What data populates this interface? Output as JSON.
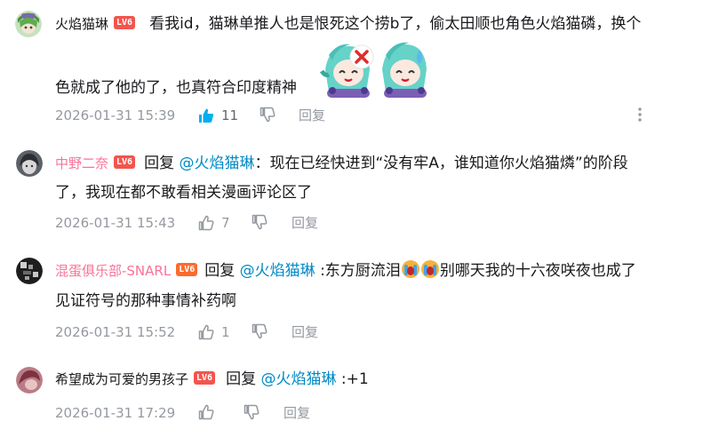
{
  "comments": [
    {
      "user": "火焰猫琳",
      "level": "LV6",
      "text_line1": "看我id，猫琳单推人也是恨死这个捞b了，偷太田顺也角色火焰猫磷，换个",
      "text_line2": "色就成了他的了，也真符合印度精神",
      "time": "2026-01-31 15:39",
      "likes": "11",
      "reply_label": "回复"
    },
    {
      "user": "中野二奈",
      "level": "LV6",
      "reply_prefix": "回复",
      "mention": "@火焰猫琳",
      "text_line1": "：现在已经快进到“没有牢A，谁知道你火焰猫燐”的阶段",
      "text_line2": "了，我现在都不敢看相关漫画评论区了",
      "time": "2026-01-31 15:43",
      "likes": "7",
      "reply_label": "回复"
    },
    {
      "user": "混蛋俱乐部-SNARL",
      "level": "LV6",
      "reply_prefix": "回复",
      "mention": "@火焰猫琳",
      "text_part_a": ":东方厨流泪",
      "text_part_b": "别哪天我的十六夜咲夜也成了",
      "text_line2": "见证符号的那种事情补药啊",
      "time": "2026-01-31 15:52",
      "likes": "1",
      "reply_label": "回复"
    },
    {
      "user": "希望成为可爱的男孩子",
      "level": "LV6",
      "reply_prefix": "回复",
      "mention": "@火焰猫琳",
      "text_line1": ":+1",
      "time": "2026-01-31 17:29",
      "likes": "",
      "reply_label": "回复"
    }
  ],
  "icons": [
    "like-icon",
    "dislike-icon",
    "more-icon",
    "sticker-image",
    "crying-emoji-icon"
  ],
  "colors": {
    "vip_pink": "#fb7299",
    "mention_blue": "#008ac5",
    "like_active_blue": "#00aeec",
    "meta_gray": "#9499a0",
    "level_red": "#f2554e",
    "level_orange": "#fd6b2d"
  }
}
